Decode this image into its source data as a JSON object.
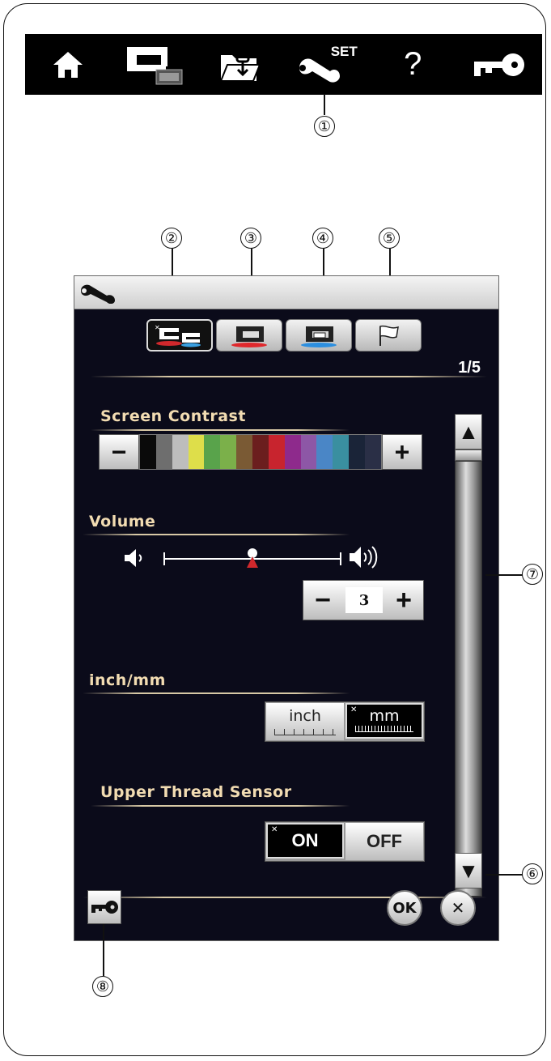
{
  "topbar": {
    "icons": [
      "home-icon",
      "sewing-machine-icon",
      "open-file-icon",
      "wrench-set-icon",
      "help-icon",
      "lock-key-icon"
    ],
    "set_label": "SET",
    "help_label": "?"
  },
  "callouts": [
    "①",
    "②",
    "③",
    "④",
    "⑤",
    "⑥",
    "⑦",
    "⑧"
  ],
  "panel": {
    "title_icon": "wrench-icon",
    "tabs": [
      {
        "icon": "common-settings-icon",
        "active": true
      },
      {
        "icon": "ordinary-sewing-icon",
        "active": false
      },
      {
        "icon": "embroidery-icon",
        "active": false
      },
      {
        "icon": "language-flag-icon",
        "active": false
      }
    ],
    "page_indicator": "1/5",
    "screen_contrast": {
      "label": "Screen Contrast",
      "minus": "−",
      "plus": "+",
      "swatches": [
        "#0a0a0a",
        "#6e6e6e",
        "#bdbdbd",
        "#dede4a",
        "#59a34b",
        "#7bb04a",
        "#7a5a34",
        "#6b1e1e",
        "#c8242e",
        "#8e2a8c",
        "#8d57a6",
        "#4a86c6",
        "#3a8fa0",
        "#1a2438",
        "#2a2f46"
      ]
    },
    "volume": {
      "label": "Volume",
      "value": "3",
      "level_fraction": 0.5,
      "minus": "−",
      "plus": "+",
      "low_icon": "speaker-low-icon",
      "high_icon": "speaker-high-icon"
    },
    "units": {
      "label": "inch/mm",
      "inch": "inch",
      "mm": "mm",
      "selected": "mm"
    },
    "thread_sensor": {
      "label": "Upper Thread Sensor",
      "on": "ON",
      "off": "OFF",
      "selected": "ON"
    },
    "scroll_up": "▲",
    "scroll_down": "▼",
    "ok_label": "OK",
    "cancel_label": "✕"
  },
  "colors": {
    "panel_bg": "#0b0b1a",
    "label_color": "#f2dcb2",
    "topbar_bg": "#000000"
  }
}
